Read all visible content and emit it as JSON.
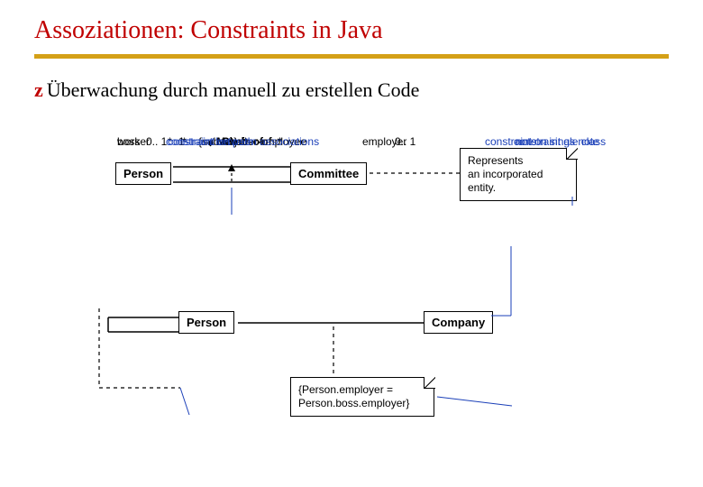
{
  "title": "Assoziationen: Constraints in Java",
  "bullet_prefix": "z",
  "bullet_text": "Überwachung durch manuell zu erstellen Code",
  "boxes": {
    "person1": "Person",
    "committee": "Committee",
    "person2": "Person",
    "company": "Company"
  },
  "assocs": {
    "member_of": "Member-of",
    "chair_of": "Chair-of",
    "subset": "{subset}"
  },
  "mults": {
    "top_left_star": "*",
    "top_right_star": "*",
    "chair_left": "1",
    "chair_right": "*",
    "worker_star": "*",
    "boss": "0.. 1",
    "person2_right": "*",
    "company_left": "0.. 1"
  },
  "roles": {
    "worker": "worker",
    "boss": "boss",
    "employee": "employee",
    "employer": "employer"
  },
  "note1_line1": "Represents",
  "note1_line2": "an incorporated",
  "note1_line3": "entity.",
  "note2_line1": "{Person.employer =",
  "note2_line2": "Person.boss.employer}",
  "annotations": {
    "between_assocs": "constraint between associations",
    "as_note": "constraint as note",
    "single_class": "constraint on single class",
    "on_path": "constraint on path",
    "note_lbl": "note"
  }
}
